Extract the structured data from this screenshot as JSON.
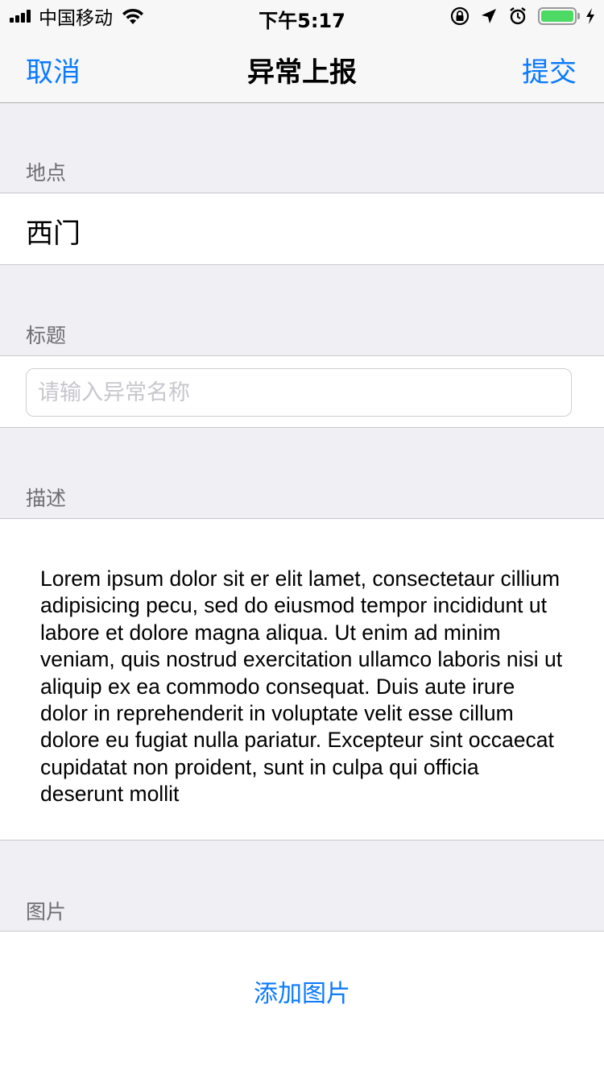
{
  "status_bar": {
    "carrier": "中国移动",
    "time": "下午5:17",
    "battery_level": 1.0,
    "icons": [
      "signal-icon",
      "wifi-icon",
      "orientation-lock-icon",
      "location-arrow-icon",
      "alarm-icon",
      "battery-icon",
      "charging-icon"
    ]
  },
  "nav": {
    "cancel": "取消",
    "title": "异常上报",
    "submit": "提交"
  },
  "form": {
    "location": {
      "header": "地点",
      "value": "西门"
    },
    "title": {
      "header": "标题",
      "placeholder": "请输入异常名称",
      "value": ""
    },
    "description": {
      "header": "描述",
      "text": "Lorem ipsum dolor sit er elit lamet, consectetaur cillium adipisicing pecu, sed do eiusmod tempor incididunt ut labore et dolore magna aliqua. Ut enim ad minim veniam, quis nostrud exercitation ullamco laboris nisi ut aliquip ex ea commodo consequat. Duis aute irure dolor in reprehenderit in voluptate velit esse cillum dolore eu fugiat nulla pariatur. Excepteur sint occaecat cupidatat non proident, sunt in culpa qui officia deserunt mollit"
    },
    "photos": {
      "header": "图片",
      "add_label": "添加图片"
    }
  },
  "colors": {
    "accent": "#0a7aff",
    "background": "#efeff4",
    "battery": "#4cd964"
  }
}
